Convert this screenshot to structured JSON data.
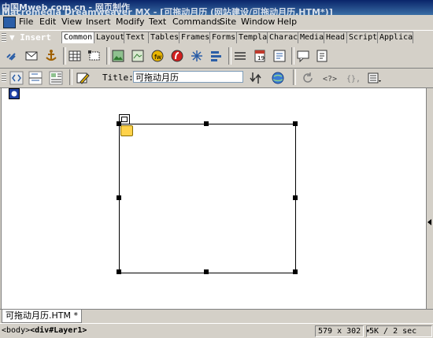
{
  "window": {
    "title": "Macromedia Dreamweaver MX - [可拖动月历 (网站建设/可拖动月历.HTM*)]",
    "title_overlay": "中国Mweb.com.cn - 网页制作"
  },
  "menu": [
    "File",
    "Edit",
    "View",
    "Insert",
    "Modify",
    "Text",
    "Commands",
    "Site",
    "Window",
    "Help"
  ],
  "insert_bar": {
    "label": "▼ Insert",
    "tabs": [
      "Common",
      "Layout",
      "Text",
      "Tables",
      "Frames",
      "Forms",
      "Templates",
      "Characters",
      "Media",
      "Head",
      "Script",
      "Application"
    ],
    "active_tab": "Common"
  },
  "insert_icons": [
    "hyperlink-icon",
    "email-link-icon",
    "named-anchor-icon",
    "table-icon",
    "draw-layer-icon",
    "image-icon",
    "image-placeholder-icon",
    "fireworks-html-icon",
    "flash-icon",
    "rollover-image-icon",
    "navigation-bar-icon",
    "horizontal-rule-icon",
    "date-icon",
    "tabular-data-icon",
    "comment-icon",
    "tag-chooser-icon"
  ],
  "document_toolbar": {
    "view_buttons": [
      "code-view-icon",
      "split-view-icon",
      "design-view-icon"
    ],
    "title_label": "Title:",
    "title_value": "可拖动月历"
  },
  "document_tab": {
    "label": "可拖动月历.HTM *"
  },
  "status": {
    "tag_body": "<body>",
    "tag_layer": "<div#Layer1>",
    "window_size": "579 x 302",
    "download": "5K / 2 sec"
  }
}
